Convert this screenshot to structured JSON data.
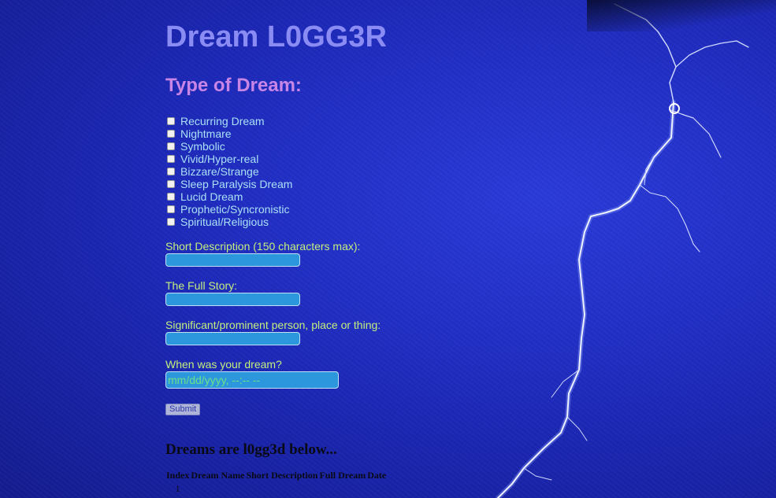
{
  "header": {
    "title": "Dream L0GG3R"
  },
  "dream_types": {
    "heading": "Type of Dream:",
    "options": [
      "Recurring Dream",
      "Nightmare",
      "Symbolic",
      "Vivid/Hyper-real",
      "Bizzare/Strange",
      "Sleep Paralysis Dream",
      "Lucid Dream",
      "Prophetic/Syncronistic",
      "Spiritual/Religious"
    ]
  },
  "form": {
    "short_description_label": "Short Description (150 characters max):",
    "full_story_label": "The Full Story:",
    "significant_label": "Significant/prominent person, place or thing:",
    "date_label": "When was your dream?",
    "date_placeholder": "mm/dd/yyyy, --:-- --",
    "submit_label": "Submit"
  },
  "log": {
    "heading": "Dreams are l0gg3d below...",
    "columns": [
      "Index",
      "Dream Name",
      "Short Description",
      "Full Dream",
      "Date"
    ],
    "rows": [
      [
        "1",
        "",
        "",
        "",
        ""
      ]
    ]
  },
  "colors": {
    "title": "#8a8cf4",
    "heading": "#c985e6",
    "checkbox_label": "#a9e0f5",
    "field_label": "#c4ee7e",
    "input_bg": "#2c97dc"
  }
}
